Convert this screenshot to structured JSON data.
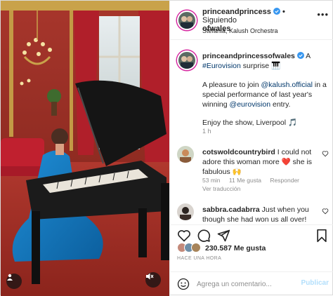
{
  "post": {
    "username_line1": "princeandprincess",
    "username_line2": "ofwales",
    "follow_label": "Siguiendo",
    "location": "Stefania, Kalush Orchestra"
  },
  "caption": {
    "username": "princeandprincessofwales",
    "line1": "A",
    "hashtag": "#Eurovision",
    "line1_end": "surprise 🎹",
    "para1_start": "A pleasure to join",
    "mention1": "@kalush.official",
    "para1_mid": "in a special performance of last year's winning",
    "mention2": "@eurovision",
    "para1_end": "entry.",
    "para2": "Enjoy the show, Liverpool 🎵",
    "time": "1 h"
  },
  "comments": [
    {
      "username": "cotswoldcountrybird",
      "text": "I could not adore this woman more ❤️ she is fabulous 🙌",
      "time": "53 min",
      "likes": "11 Me gusta",
      "reply": "Responder",
      "translate": "Ver traducción"
    },
    {
      "username": "sabbra.cadabrra",
      "text": "Just when you though she had won us all over!"
    }
  ],
  "likes": {
    "count": "230.587 Me gusta"
  },
  "timestamp": "HACE UNA HORA",
  "composer": {
    "placeholder": "Agrega un comentario...",
    "post_label": "Publicar"
  },
  "colors": {
    "link": "#00376b",
    "verified": "#3897f0",
    "post_button_disabled": "#b2dffc",
    "heart": "#ed4956"
  },
  "icons": [
    "more-icon",
    "verified-icon",
    "heart-icon",
    "comment-icon",
    "share-icon",
    "bookmark-icon",
    "emoji-icon",
    "user-tag-icon",
    "mute-icon"
  ]
}
